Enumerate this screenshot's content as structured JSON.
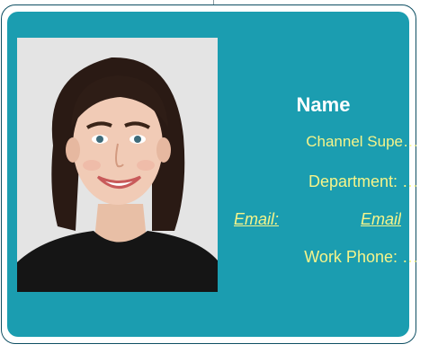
{
  "card": {
    "name": "Name",
    "title": "Channel Supe…",
    "department": "Department:  …",
    "email_label": "Email:",
    "email_value": "Email",
    "phone": "Work Phone: …"
  },
  "colors": {
    "card_bg": "#1b9db0",
    "text_accent": "#f6f48a",
    "name_text": "#ffffff"
  }
}
